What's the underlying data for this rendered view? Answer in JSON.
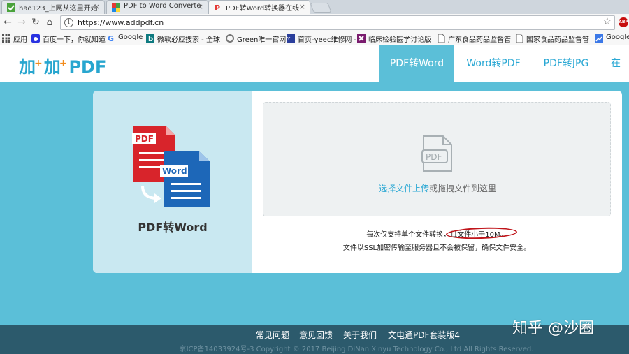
{
  "browser": {
    "tabs": [
      {
        "label": "hao123_上网从这里开始",
        "active": false
      },
      {
        "label": "PDF to Word Converte",
        "active": false
      },
      {
        "label": "PDF转Word转换器在线",
        "active": true
      }
    ],
    "url": "https://www.addpdf.cn",
    "bookmarks": [
      "应用",
      "百度一下，你就知道",
      "Google",
      "微软必应搜索 - 全球",
      "Green唯一官网",
      "首页-yeec维修网 -",
      "临床检验医学讨论版",
      "广东食品药品监督管",
      "国家食品药品监督管",
      "Google"
    ]
  },
  "site": {
    "logo": {
      "text1": "加",
      "text2": "加",
      "text3": "PDF",
      "plus": "+"
    },
    "nav": [
      "PDF转Word",
      "Word转PDF",
      "PDF转JPG",
      "在线"
    ]
  },
  "converter": {
    "title": "PDF转Word",
    "badge_pdf": "PDF",
    "badge_word": "Word",
    "upload_icon_label": "PDF",
    "hint_link": "选择文件上传",
    "hint_text": "或拖拽文件到这里",
    "note1": "每次仅支持单个文件转换，且文件小于10M。",
    "note2": "文件以SSL加密传输至服务器且不会被保留，确保文件安全。"
  },
  "footer": {
    "links": [
      "常见问题",
      "意见回馈",
      "关于我们",
      "文电通PDF套装版4"
    ],
    "copyright": "京ICP备14033924号-3 Copyright © 2017 Beijing DiNan Xinyu Technology Co., Ltd All Rights Reserved."
  },
  "watermark": "知乎 @沙圈",
  "colors": {
    "accent": "#5bbfd8",
    "link": "#2aa8d4",
    "pdf_red": "#d8242b",
    "word_blue": "#1d67b8",
    "footer": "#2c5a6c",
    "annotation": "#c0151b"
  }
}
